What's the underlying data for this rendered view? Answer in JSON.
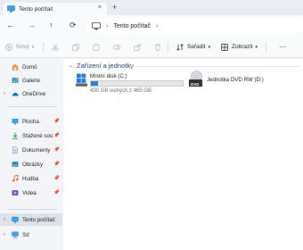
{
  "window": {
    "tab_title": "Tento počítač",
    "tab_close": "×",
    "new_tab": "+"
  },
  "nav": {
    "back": "←",
    "forward": "→",
    "up": "↑",
    "refresh": "⟳",
    "breadcrumb": [
      "Tento počítač"
    ],
    "breadcrumb_chevron": "›"
  },
  "toolbar": {
    "new_label": "Nový",
    "sort_label": "Seřadit",
    "view_label": "Zobrazit",
    "more_label": "···"
  },
  "sidebar": {
    "top_items": [
      {
        "label": "Domů",
        "icon": "home-icon"
      },
      {
        "label": "Galerie",
        "icon": "gallery-icon"
      },
      {
        "label": "OneDrive",
        "icon": "onedrive-icon"
      }
    ],
    "pinned_items": [
      {
        "label": "Plocha",
        "icon": "desktop-folder-icon"
      },
      {
        "label": "Stažené soubory",
        "icon": "downloads-folder-icon"
      },
      {
        "label": "Dokumenty",
        "icon": "documents-folder-icon"
      },
      {
        "label": "Obrázky",
        "icon": "pictures-folder-icon"
      },
      {
        "label": "Hudba",
        "icon": "music-folder-icon"
      },
      {
        "label": "Videa",
        "icon": "videos-folder-icon"
      }
    ],
    "bottom_items": [
      {
        "label": "Tento počítač",
        "icon": "this-pc-icon",
        "selected": true
      },
      {
        "label": "Síť",
        "icon": "network-icon"
      }
    ]
  },
  "content": {
    "group_title": "Zařízení a jednotky",
    "drives": [
      {
        "name": "Místní disk (C:)",
        "space": "430 GB volných z 465 GB",
        "used_fraction": 0.075
      },
      {
        "name": "Jednotka DVD RW (D:)",
        "badge": "DVD"
      }
    ]
  },
  "colors": {
    "accent": "#2f7fd1",
    "selection": "#dde3ea"
  }
}
